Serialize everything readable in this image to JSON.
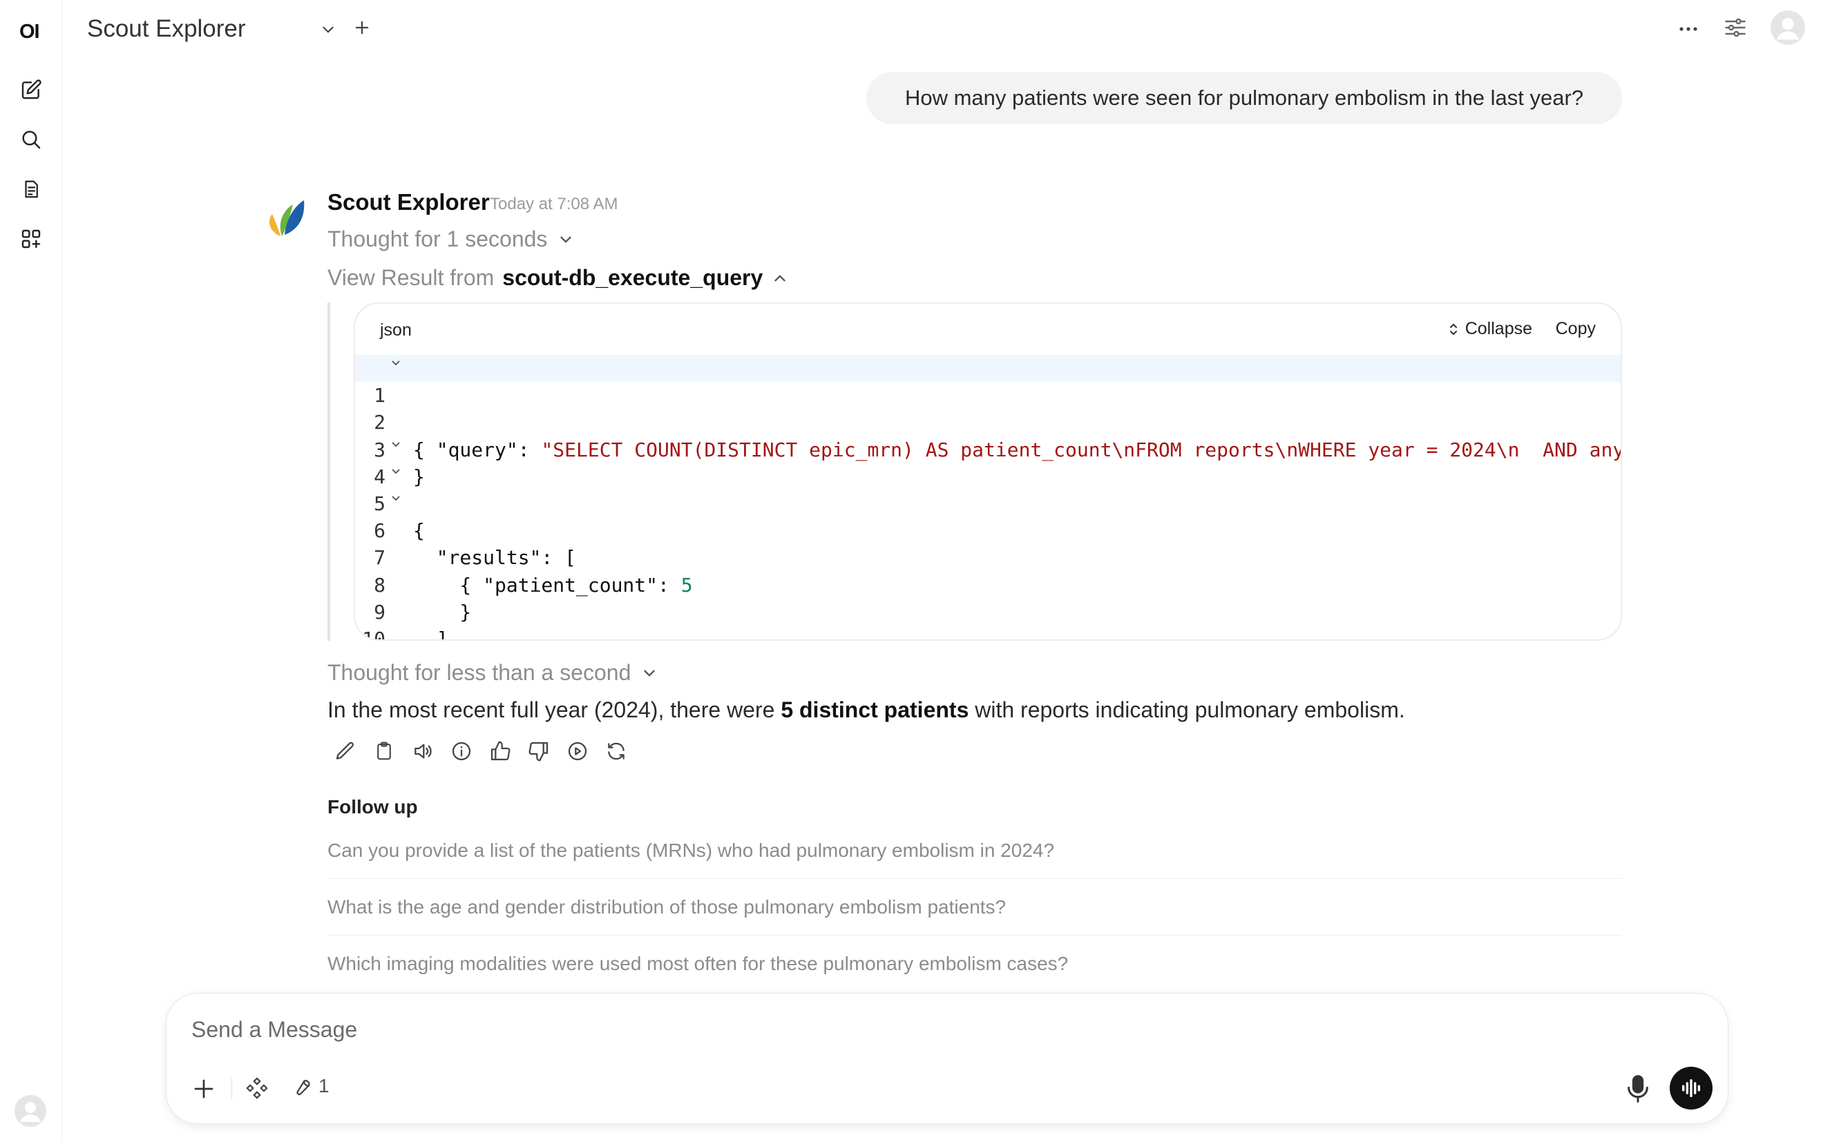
{
  "sidebar": {
    "logo": "OI",
    "items": [
      {
        "name": "new-chat",
        "icon": "edit-icon"
      },
      {
        "name": "search",
        "icon": "search-icon"
      },
      {
        "name": "notes",
        "icon": "notes-icon"
      },
      {
        "name": "workspace",
        "icon": "apps-icon"
      }
    ]
  },
  "header": {
    "title": "Scout Explorer"
  },
  "user_message": "How many patients were seen for pulmonary embolism in the last year?",
  "assistant": {
    "name": "Scout Explorer",
    "timestamp": "Today at 7:08 AM",
    "thought_1": "Thought for 1 seconds",
    "view_result_prefix": "View Result from",
    "tool_name": "scout-db_execute_query",
    "code": {
      "lang": "json",
      "collapse_label": "Collapse",
      "copy_label": "Copy",
      "lines": [
        {
          "n": "1",
          "text": "{"
        },
        {
          "n": "2",
          "key": "  \"query\": ",
          "str": "\"SELECT COUNT(DISTINCT epic_mrn) AS patient_count\\nFROM reports\\nWHERE year = 2024\\n  AND any"
        },
        {
          "n": "3",
          "text": "}"
        },
        {
          "n": "4",
          "text": "{"
        },
        {
          "n": "5",
          "text": "  \"results\": ["
        },
        {
          "n": "6",
          "text": "    {"
        },
        {
          "n": "7",
          "key": "      \"patient_count\": ",
          "num": "5"
        },
        {
          "n": "8",
          "text": "    }"
        },
        {
          "n": "9",
          "text": "  ]"
        },
        {
          "n": "10",
          "text": "}"
        }
      ]
    },
    "thought_2": "Thought for less than a second",
    "answer_pre": "In the most recent full year (2024), there were ",
    "answer_bold": "5 distinct patients",
    "answer_post": " with reports indicating pulmonary embolism.",
    "actions": [
      "edit-icon",
      "copy-icon",
      "read-aloud-icon",
      "info-icon",
      "thumbs-up-icon",
      "thumbs-down-icon",
      "continue-icon",
      "regenerate-icon"
    ]
  },
  "followup": {
    "title": "Follow up",
    "items": [
      "Can you provide a list of the patients (MRNs) who had pulmonary embolism in 2024?",
      "What is the age and gender distribution of those pulmonary embolism patients?",
      "Which imaging modalities were used most often for these pulmonary embolism cases?"
    ]
  },
  "composer": {
    "placeholder": "Send a Message",
    "tools_count": "1"
  }
}
